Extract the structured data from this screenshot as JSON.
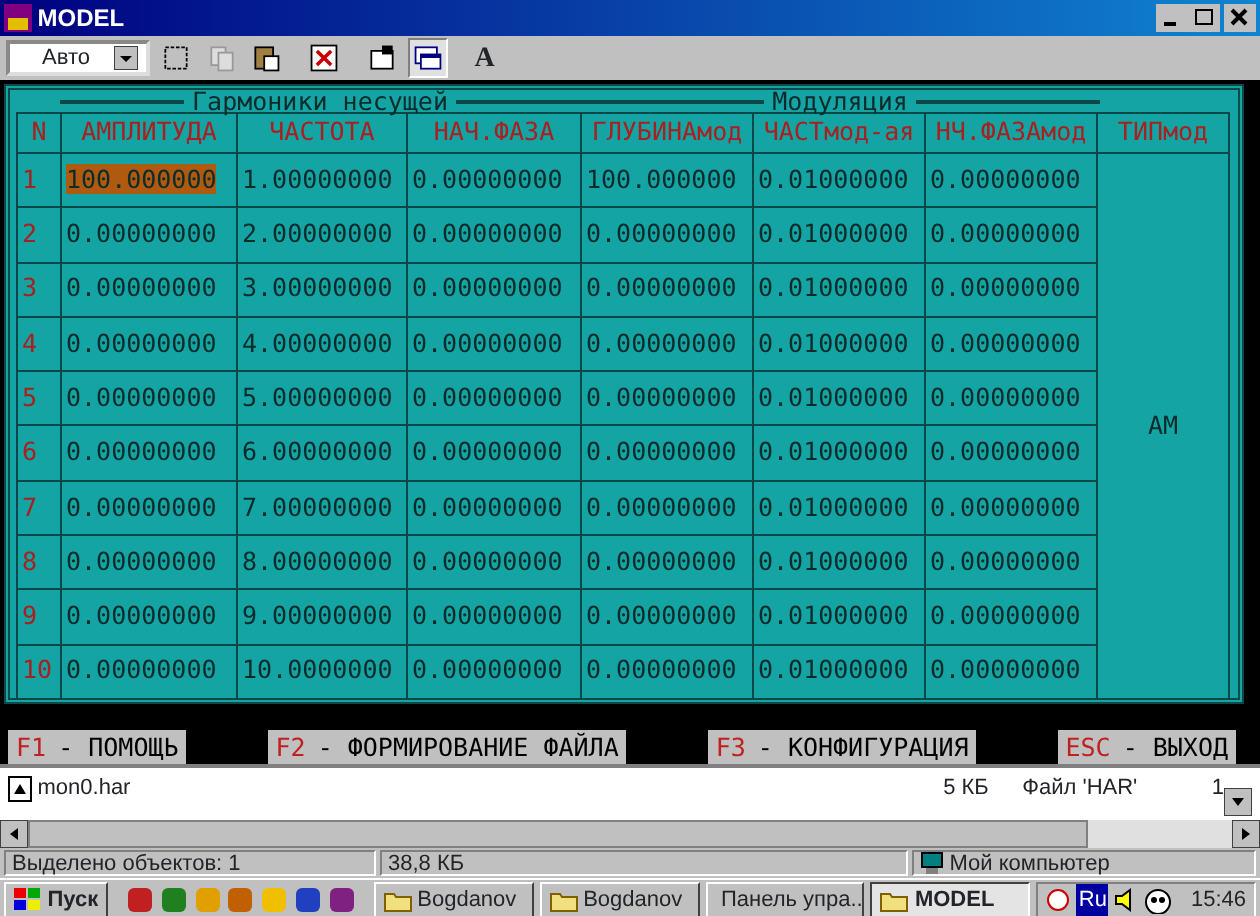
{
  "window": {
    "title": "MODEL"
  },
  "toolbar": {
    "font_size": "Авто",
    "letter_button": "A"
  },
  "table": {
    "groups": [
      "Гармоники несущей",
      "Модуляция"
    ],
    "columns": [
      "N",
      "АМПЛИТУДА",
      "ЧАСТОТА",
      "НАЧ.ФАЗА",
      "ГЛУБИНАмод",
      "ЧАСТмод-ая",
      "НЧ.ФАЗАмод",
      "ТИПмод"
    ],
    "modulation_type": "AM",
    "rows": [
      {
        "cells": [
          {
            "text": "1",
            "selected": false
          },
          {
            "text": "100.000000",
            "selected": true
          },
          {
            "text": "1.00000000",
            "selected": false
          },
          {
            "text": "0.00000000",
            "selected": false
          },
          {
            "text": "100.000000",
            "selected": false
          },
          {
            "text": "0.01000000",
            "selected": false
          },
          {
            "text": "0.00000000",
            "selected": false
          }
        ]
      },
      {
        "cells": [
          {
            "text": "2",
            "selected": false
          },
          {
            "text": "0.00000000",
            "selected": false
          },
          {
            "text": "2.00000000",
            "selected": false
          },
          {
            "text": "0.00000000",
            "selected": false
          },
          {
            "text": "0.00000000",
            "selected": false
          },
          {
            "text": "0.01000000",
            "selected": false
          },
          {
            "text": "0.00000000",
            "selected": false
          }
        ]
      },
      {
        "cells": [
          {
            "text": "3",
            "selected": false
          },
          {
            "text": "0.00000000",
            "selected": false
          },
          {
            "text": "3.00000000",
            "selected": false
          },
          {
            "text": "0.00000000",
            "selected": false
          },
          {
            "text": "0.00000000",
            "selected": false
          },
          {
            "text": "0.01000000",
            "selected": false
          },
          {
            "text": "0.00000000",
            "selected": false
          }
        ]
      },
      {
        "cells": [
          {
            "text": "4",
            "selected": false
          },
          {
            "text": "0.00000000",
            "selected": false
          },
          {
            "text": "4.00000000",
            "selected": false
          },
          {
            "text": "0.00000000",
            "selected": false
          },
          {
            "text": "0.00000000",
            "selected": false
          },
          {
            "text": "0.01000000",
            "selected": false
          },
          {
            "text": "0.00000000",
            "selected": false
          }
        ]
      },
      {
        "cells": [
          {
            "text": "5",
            "selected": false
          },
          {
            "text": "0.00000000",
            "selected": false
          },
          {
            "text": "5.00000000",
            "selected": false
          },
          {
            "text": "0.00000000",
            "selected": false
          },
          {
            "text": "0.00000000",
            "selected": false
          },
          {
            "text": "0.01000000",
            "selected": false
          },
          {
            "text": "0.00000000",
            "selected": false
          }
        ]
      },
      {
        "cells": [
          {
            "text": "6",
            "selected": false
          },
          {
            "text": "0.00000000",
            "selected": false
          },
          {
            "text": "6.00000000",
            "selected": false
          },
          {
            "text": "0.00000000",
            "selected": false
          },
          {
            "text": "0.00000000",
            "selected": false
          },
          {
            "text": "0.01000000",
            "selected": false
          },
          {
            "text": "0.00000000",
            "selected": false
          }
        ]
      },
      {
        "cells": [
          {
            "text": "7",
            "selected": false
          },
          {
            "text": "0.00000000",
            "selected": false
          },
          {
            "text": "7.00000000",
            "selected": false
          },
          {
            "text": "0.00000000",
            "selected": false
          },
          {
            "text": "0.00000000",
            "selected": false
          },
          {
            "text": "0.01000000",
            "selected": false
          },
          {
            "text": "0.00000000",
            "selected": false
          }
        ]
      },
      {
        "cells": [
          {
            "text": "8",
            "selected": false
          },
          {
            "text": "0.00000000",
            "selected": false
          },
          {
            "text": "8.00000000",
            "selected": false
          },
          {
            "text": "0.00000000",
            "selected": false
          },
          {
            "text": "0.00000000",
            "selected": false
          },
          {
            "text": "0.01000000",
            "selected": false
          },
          {
            "text": "0.00000000",
            "selected": false
          }
        ]
      },
      {
        "cells": [
          {
            "text": "9",
            "selected": false
          },
          {
            "text": "0.00000000",
            "selected": false
          },
          {
            "text": "9.00000000",
            "selected": false
          },
          {
            "text": "0.00000000",
            "selected": false
          },
          {
            "text": "0.00000000",
            "selected": false
          },
          {
            "text": "0.01000000",
            "selected": false
          },
          {
            "text": "0.00000000",
            "selected": false
          }
        ]
      },
      {
        "cells": [
          {
            "text": "10",
            "selected": false
          },
          {
            "text": "0.00000000",
            "selected": false
          },
          {
            "text": "10.0000000",
            "selected": false
          },
          {
            "text": "0.00000000",
            "selected": false
          },
          {
            "text": "0.00000000",
            "selected": false
          },
          {
            "text": "0.01000000",
            "selected": false
          },
          {
            "text": "0.00000000",
            "selected": false
          }
        ]
      }
    ]
  },
  "function_keys": [
    {
      "key": "F1",
      "label": "- ПОМОЩЬ"
    },
    {
      "key": "F2",
      "label": "- ФОРМИРОВАНИЕ ФАЙЛА"
    },
    {
      "key": "F3",
      "label": "- КОНФИГУРАЦИЯ"
    },
    {
      "key": "ESC",
      "label": "- ВЫХОД"
    }
  ],
  "file_list": [
    {
      "name": "mon0.har",
      "size": "5 КБ",
      "type": "Файл 'HAR'",
      "column_4": "1"
    }
  ],
  "status_bar": {
    "selection": "Выделено объектов: 1",
    "size": "38,8 КБ",
    "location": "Мой компьютер"
  },
  "taskbar": {
    "start": "Пуск",
    "tasks": [
      {
        "label": "Bogdanov",
        "selected": false
      },
      {
        "label": "Bogdanov",
        "selected": false
      },
      {
        "label": "Панель упра...",
        "selected": false
      },
      {
        "label": "MODEL",
        "selected": true
      }
    ],
    "language": "Ru",
    "clock": "15:46"
  }
}
